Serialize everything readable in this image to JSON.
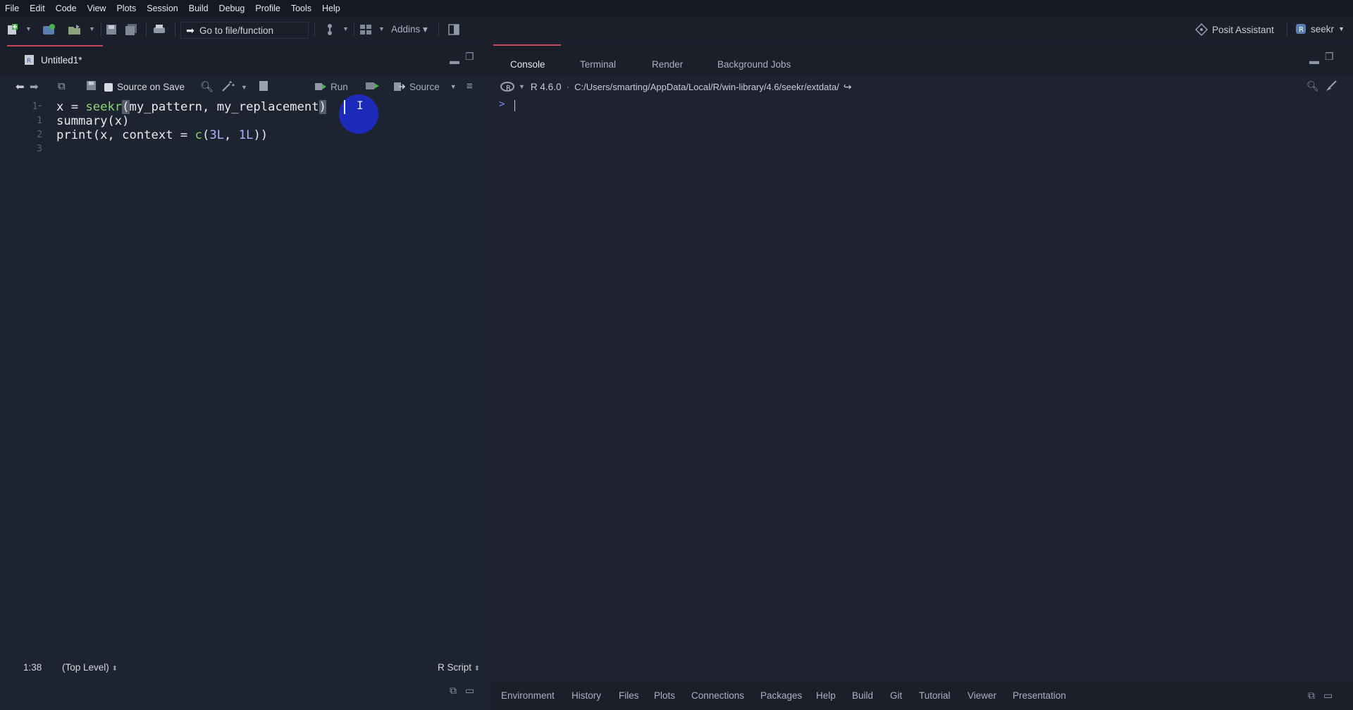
{
  "menu": [
    "File",
    "Edit",
    "Code",
    "View",
    "Plots",
    "Session",
    "Build",
    "Debug",
    "Profile",
    "Tools",
    "Help"
  ],
  "toolbar": {
    "goto_placeholder": "Go to file/function",
    "addins_label": "Addins",
    "posit_assistant": "Posit Assistant",
    "project_name": "seekr"
  },
  "editor": {
    "file_tab": "Untitled1*",
    "source_on_save": "Source on Save",
    "run_label": "Run",
    "source_label": "Source",
    "line_numbers": [
      "1",
      "1",
      "2",
      "3"
    ],
    "code": {
      "line1_a": "x = ",
      "line1_fn": "seekr",
      "line1_paren_open": "(",
      "line1_args": "my_pattern, my_replacement",
      "line1_paren_close": ")",
      "line2": "summary(x)",
      "line3_a": "print(x, context = ",
      "line3_fn": "c",
      "line3_b": "(",
      "line3_n1": "3L",
      "line3_c": ", ",
      "line3_n2": "1L",
      "line3_d": "))"
    },
    "status": {
      "position": "1:38",
      "scope": "(Top Level)",
      "file_type": "R Script"
    }
  },
  "console": {
    "tabs": [
      "Console",
      "Terminal",
      "Render",
      "Background Jobs"
    ],
    "r_version": "R 4.6.0",
    "path": "C:/Users/smarting/AppData/Local/R/win-library/4.6/seekr/extdata/",
    "prompt": ">"
  },
  "bottom_tabs": [
    "Environment",
    "History",
    "Files",
    "Plots",
    "Connections",
    "Packages",
    "Help",
    "Build",
    "Git",
    "Tutorial",
    "Viewer",
    "Presentation"
  ],
  "colors": {
    "accent": "#c8475d",
    "function": "#8bd47a",
    "number": "#a6b6ff",
    "click_indicator": "#1c2cc4"
  }
}
